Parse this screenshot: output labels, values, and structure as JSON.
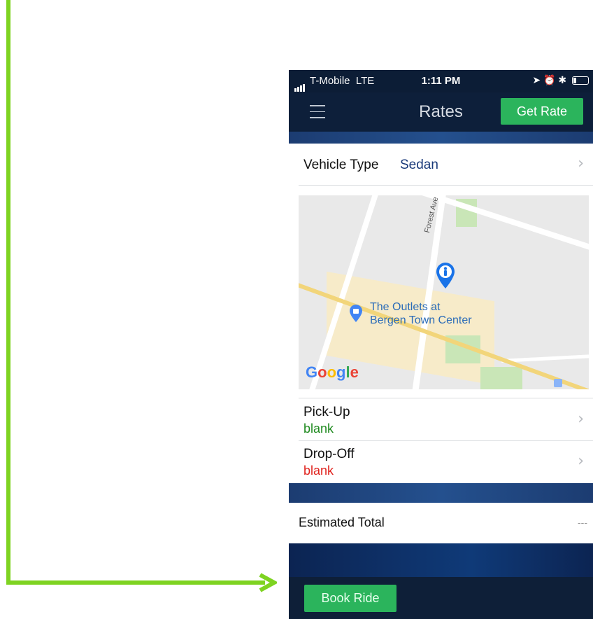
{
  "status_bar": {
    "carrier": "T-Mobile",
    "network": "LTE",
    "time": "1:11 PM",
    "icons": [
      "location-arrow-icon",
      "alarm-icon",
      "bluetooth-icon",
      "battery-icon"
    ]
  },
  "nav": {
    "menu_icon": "hamburger-menu-icon",
    "title": "Rates",
    "get_rate_label": "Get Rate"
  },
  "vehicle": {
    "label": "Vehicle Type",
    "value": "Sedan"
  },
  "map": {
    "street_label": "Forest Ave",
    "poi_label_line1": "The Outlets at",
    "poi_label_line2": "Bergen Town Center",
    "logo_text": "Google",
    "colors": {
      "water_blue": "#8ab4f8",
      "highway": "#f2d57a",
      "park": "#c9e6b7",
      "pin": "#1a73e8"
    }
  },
  "pickup": {
    "label": "Pick-Up",
    "value": "blank"
  },
  "dropoff": {
    "label": "Drop-Off",
    "value": "blank"
  },
  "estimate": {
    "label": "Estimated Total",
    "value": "---"
  },
  "footer": {
    "book_ride_label": "Book Ride"
  },
  "colors": {
    "accent_green": "#2bb45c",
    "nav_dark": "#0d1f3a",
    "pickup_green": "#1f8a1f",
    "dropoff_red": "#e0231e",
    "arrow_green": "#7ed321"
  }
}
